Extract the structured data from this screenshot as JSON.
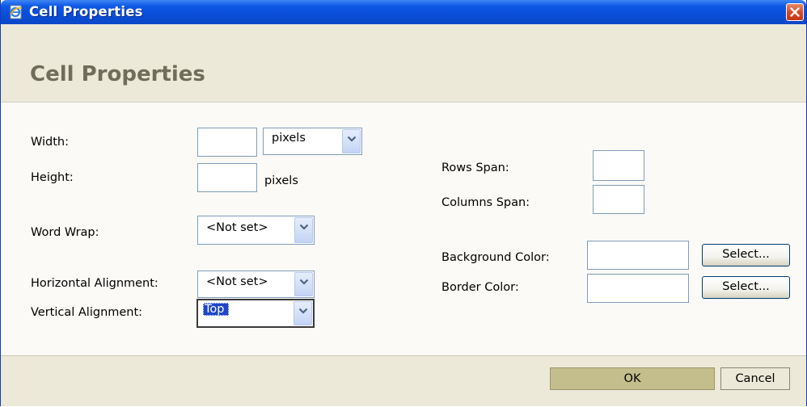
{
  "window": {
    "title": "Cell Properties",
    "title_icon": "ie-page-icon",
    "close_icon": "close-icon"
  },
  "header": {
    "title": "Cell Properties"
  },
  "form": {
    "width_label": "Width:",
    "width_value": "",
    "width_unit_selected": "pixels",
    "height_label": "Height:",
    "height_value": "",
    "height_unit": "pixels",
    "word_wrap_label": "Word Wrap:",
    "word_wrap_selected": "<Not set>",
    "h_align_label": "Horizontal Alignment:",
    "h_align_selected": "<Not set>",
    "v_align_label": "Vertical Alignment:",
    "v_align_selected": "Top",
    "rows_span_label": "Rows Span:",
    "rows_span_value": "",
    "cols_span_label": "Columns Span:",
    "cols_span_value": "",
    "bg_color_label": "Background Color:",
    "bg_color_value": "",
    "bg_select_label": "Select...",
    "border_color_label": "Border Color:",
    "border_color_value": "",
    "border_select_label": "Select..."
  },
  "footer": {
    "ok_label": "OK",
    "cancel_label": "Cancel"
  },
  "colors": {
    "titlebar_blue": "#0a4ed8",
    "dialog_bg": "#fbfaf6",
    "band_bg": "#ece9d8",
    "header_text": "#6e6e5a",
    "selection_blue": "#2046c8",
    "close_red": "#d84a23",
    "ok_button": "#c4bd8c"
  }
}
